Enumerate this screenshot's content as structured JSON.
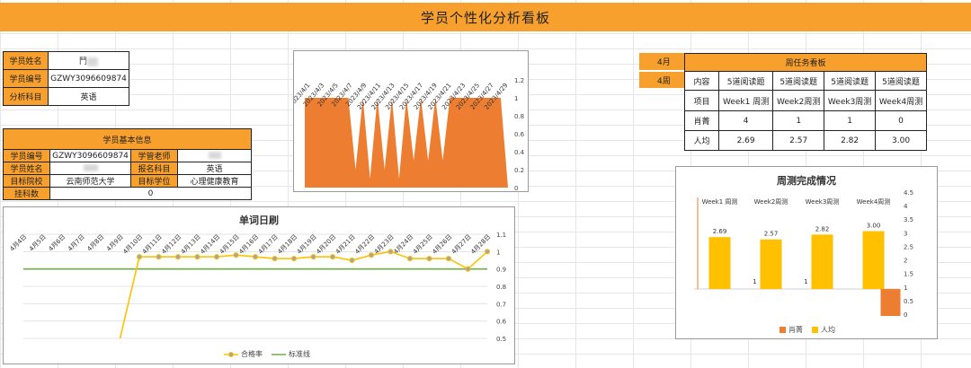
{
  "header": {
    "title": "学员个性化分析看板"
  },
  "student_summary": {
    "rows": [
      {
        "label": "学员姓名",
        "value": "鬥"
      },
      {
        "label": "学员编号",
        "value": "GZWY3096609874"
      },
      {
        "label": "分析科目",
        "value": "英语"
      }
    ]
  },
  "basic_info": {
    "title": "学员基本信息",
    "student_id_label": "学员编号",
    "student_id": "GZWY3096609874",
    "teacher_label": "学管老师",
    "name_label": "学员姓名",
    "subject_label": "报名科目",
    "subject": "英语",
    "target_school_label": "目标院校",
    "target_school": "云南师范大学",
    "target_degree_label": "目标学位",
    "target_degree": "心理健康教育",
    "fail_label": "挂科数",
    "fail_count": "0"
  },
  "weekly_board": {
    "month": "4月",
    "week": "4周",
    "title": "周任务看板",
    "rows": [
      [
        "内容",
        "5道阅读题",
        "5道阅读题",
        "5道阅读题",
        "5道阅读题"
      ],
      [
        "项目",
        "Week1 周测",
        "Week2周测",
        "Week3周测",
        "Week4周测"
      ],
      [
        "肖菁",
        "4",
        "1",
        "1",
        "0"
      ],
      [
        "人均",
        "2.69",
        "2.57",
        "2.82",
        "3.00"
      ]
    ]
  },
  "chart_data": [
    {
      "type": "area",
      "categories": [
        "2023/4/1",
        "2023/4/3",
        "2023/4/5",
        "2023/4/7",
        "2023/4/9",
        "2023/4/11",
        "2023/4/13",
        "2023/4/15",
        "2023/4/17",
        "2023/4/19",
        "2023/4/21",
        "2023/4/23",
        "2023/4/25",
        "2023/4/27",
        "2023/4/29"
      ],
      "values": [
        1,
        1,
        1,
        1,
        1,
        1,
        1,
        0.2,
        1,
        0.1,
        1,
        0.2,
        1,
        0.1,
        1,
        0.3,
        1,
        0.3,
        1,
        0.3,
        1,
        1,
        1,
        1,
        1,
        1,
        1,
        1,
        0
      ],
      "yticks": [
        "1.2",
        "1",
        "0.8",
        "0.6",
        "0.4",
        "0.2",
        "0"
      ],
      "ylim": [
        0,
        1.2
      ],
      "color": "#ed7d31"
    },
    {
      "type": "line",
      "title": "单词日刷",
      "categories": [
        "4月4日",
        "4月5日",
        "4月6日",
        "4月7日",
        "4月8日",
        "4月9日",
        "4月10日",
        "4月11日",
        "4月12日",
        "4月13日",
        "4月14日",
        "4月15日",
        "4月16日",
        "4月17日",
        "4月18日",
        "4月19日",
        "4月20日",
        "4月21日",
        "4月22日",
        "4月23日",
        "4月24日",
        "4月25日",
        "4月26日",
        "4月27日",
        "4月28日"
      ],
      "series": [
        {
          "name": "合格率",
          "color": "#ffc000",
          "values": [
            null,
            null,
            null,
            null,
            null,
            0.5,
            0.97,
            0.97,
            0.97,
            0.97,
            0.97,
            0.98,
            0.97,
            0.96,
            0.96,
            0.97,
            0.97,
            0.95,
            0.98,
            1.0,
            0.96,
            0.96,
            0.96,
            0.9,
            1.0
          ]
        },
        {
          "name": "标准线",
          "color": "#70ad47",
          "values": [
            0.9,
            0.9,
            0.9,
            0.9,
            0.9,
            0.9,
            0.9,
            0.9,
            0.9,
            0.9,
            0.9,
            0.9,
            0.9,
            0.9,
            0.9,
            0.9,
            0.9,
            0.9,
            0.9,
            0.9,
            0.9,
            0.9,
            0.9,
            0.9,
            0.9
          ]
        }
      ],
      "yticks": [
        "1.1",
        "1",
        "0.9",
        "0.8",
        "0.7",
        "0.6",
        "0.5"
      ],
      "ylim": [
        0.5,
        1.1
      ]
    },
    {
      "type": "bar",
      "title": "周测完成情况",
      "categories": [
        "Week1 周测",
        "Week2周测",
        "Week3周测",
        "Week4周测"
      ],
      "series": [
        {
          "name": "肖菁",
          "color": "#ed7d31",
          "values": [
            4,
            1,
            1,
            0
          ]
        },
        {
          "name": "人均",
          "color": "#ffc000",
          "values": [
            2.69,
            2.57,
            2.82,
            3.0
          ]
        }
      ],
      "data_labels_avg": [
        "2.69",
        "2.57",
        "2.82",
        "3.00"
      ],
      "data_labels_xj": [
        "1",
        "1"
      ],
      "yticks": [
        "4.5",
        "4",
        "3.5",
        "3",
        "2.5",
        "2",
        "1.5",
        "1",
        "0.5",
        "0"
      ],
      "ylim": [
        0,
        4.5
      ]
    }
  ]
}
